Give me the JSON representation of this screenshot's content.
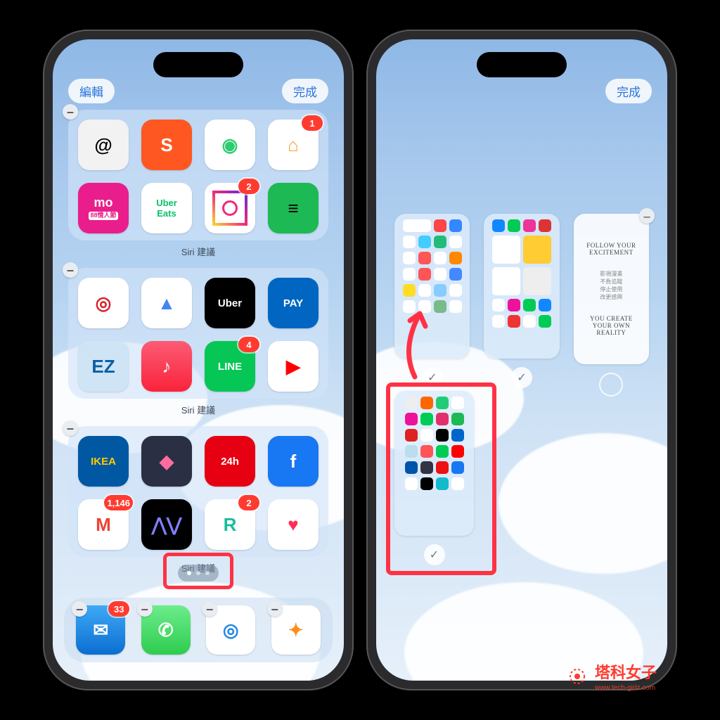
{
  "left": {
    "btn_edit": "編輯",
    "btn_done": "完成",
    "widget_label": "Siri 建議",
    "w1_apps": [
      {
        "name": "Threads",
        "bg": "#f2f2f2",
        "fg": "#000",
        "glyph": "@"
      },
      {
        "name": "Shopee",
        "bg": "#ff5722",
        "fg": "#fff",
        "glyph": "S"
      },
      {
        "name": "Find My",
        "bg": "#ffffff",
        "fg": "#2ecc71",
        "glyph": "◉"
      },
      {
        "name": "Home",
        "bg": "#ffffff",
        "fg": "#ff9933",
        "glyph": "⌂",
        "badge": "1"
      },
      {
        "name": "momo",
        "bg": "#e91e8c",
        "fg": "#fff",
        "glyph": "mo",
        "sub": "88情人節"
      },
      {
        "name": "Uber Eats",
        "bg": "#ffffff",
        "fg": "#06c167",
        "glyph": "Uber\nEats"
      },
      {
        "name": "Instagram",
        "bg": "#ffffff",
        "fg": "#e1306c",
        "glyph": "◯",
        "badge": "2",
        "ig": true
      },
      {
        "name": "Spotify",
        "bg": "#1db954",
        "fg": "#000",
        "glyph": "≡"
      }
    ],
    "w2_apps": [
      {
        "name": "PX",
        "bg": "#ffffff",
        "fg": "#d91f2a",
        "glyph": "◎"
      },
      {
        "name": "Maps",
        "bg": "#ffffff",
        "fg": "#4285f4",
        "glyph": "▲"
      },
      {
        "name": "Uber",
        "bg": "#000000",
        "fg": "#fff",
        "glyph": "Uber"
      },
      {
        "name": "PXPay",
        "bg": "#0066c2",
        "fg": "#fff",
        "glyph": "PAY"
      },
      {
        "name": "EZWay",
        "bg": "#cfe4f5",
        "fg": "#0b5fa5",
        "glyph": "EZ"
      },
      {
        "name": "Music",
        "bg": "linear-gradient(#fb5c74,#fa233b)",
        "fg": "#fff",
        "glyph": "♪"
      },
      {
        "name": "LINE",
        "bg": "#06c755",
        "fg": "#fff",
        "glyph": "LINE",
        "badge": "4"
      },
      {
        "name": "YouTube",
        "bg": "#ffffff",
        "fg": "#ff0000",
        "glyph": "▶"
      }
    ],
    "w3_apps": [
      {
        "name": "IKEA",
        "bg": "#0058a3",
        "fg": "#ffcc00",
        "glyph": "IKEA"
      },
      {
        "name": "Shortcuts",
        "bg": "#2b2f44",
        "fg": "#ff6da0",
        "glyph": "◆"
      },
      {
        "name": "PChome",
        "bg": "#e60012",
        "fg": "#fff",
        "glyph": "24h"
      },
      {
        "name": "Facebook",
        "bg": "#1877f2",
        "fg": "#fff",
        "glyph": "f"
      },
      {
        "name": "Gmail",
        "bg": "#ffffff",
        "fg": "#ea4335",
        "glyph": "M",
        "badge": "1,146"
      },
      {
        "name": "Stocks",
        "bg": "#000000",
        "fg": "#7f7fff",
        "glyph": "⋀⋁"
      },
      {
        "name": "Rakuten",
        "bg": "#ffffff",
        "fg": "#1abc9c",
        "glyph": "R",
        "badge": "2"
      },
      {
        "name": "Health",
        "bg": "#ffffff",
        "fg": "#ff2d55",
        "glyph": "♥"
      }
    ],
    "dock": [
      {
        "name": "Mail",
        "bg": "linear-gradient(#3fa9f5,#0a6ed1)",
        "fg": "#fff",
        "glyph": "✉",
        "badge": "33"
      },
      {
        "name": "Phone",
        "bg": "linear-gradient(#6dec8c,#2ecc4f)",
        "fg": "#fff",
        "glyph": "✆"
      },
      {
        "name": "Safari",
        "bg": "#ffffff",
        "fg": "#1e88e5",
        "glyph": "◎"
      },
      {
        "name": "Planet",
        "bg": "#ffffff",
        "fg": "#ff8c1a",
        "glyph": "✦"
      }
    ]
  },
  "right": {
    "btn_done": "完成",
    "quote1": "FOLLOW YOUR EXCITEMENT",
    "quote_mid": "影視漫畫\n不負追蹤\n停止使用\n改更感興",
    "quote2": "YOU CREATE YOUR OWN REALITY"
  },
  "watermark": {
    "name": "塔科女子",
    "url": "www.tech-girlz.com"
  }
}
